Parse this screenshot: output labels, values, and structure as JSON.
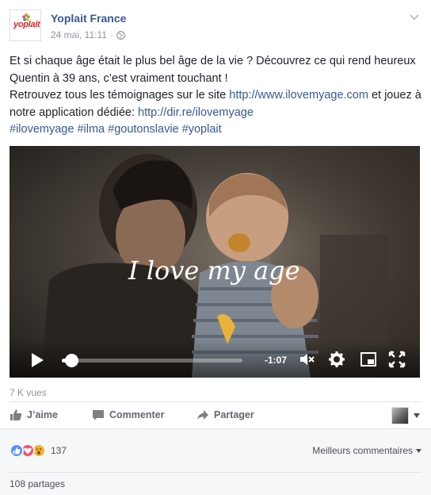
{
  "post": {
    "page_name": "Yoplait France",
    "logo_text": "yoplait",
    "timestamp": "24 mai, 11:11",
    "dot": "·",
    "text": {
      "line1": "Et si chaque âge était le plus bel âge de la vie ? Découvrez ce qui rend heureux Quentin à 39 ans, c’est vraiment touchant !",
      "line2_prefix": "Retrouvez tous les témoignages sur le site ",
      "line2_link": "http://www.ilovemyage.com",
      "line2_mid": " et jouez à notre application dédiée: ",
      "line2_link2": "http://dir.re/ilovemyage",
      "hashtags": [
        "#ilovemyage",
        "#ilma",
        "#goutonslavie",
        "#yoplait"
      ]
    }
  },
  "video": {
    "overlay_text": "I love my age",
    "time_remaining": "-1:07",
    "progress": 0.04
  },
  "stats": {
    "views": "7 K vues",
    "reaction_count": "137",
    "shares": "108 partages",
    "best_comments": "Meilleurs commentaires"
  },
  "actions": {
    "like": "J’aime",
    "comment": "Commenter",
    "share": "Partager"
  },
  "colors": {
    "link": "#365899",
    "like_blue": "#5890ff",
    "love_red": "#f25268",
    "wow_yellow": "#f7b125"
  }
}
